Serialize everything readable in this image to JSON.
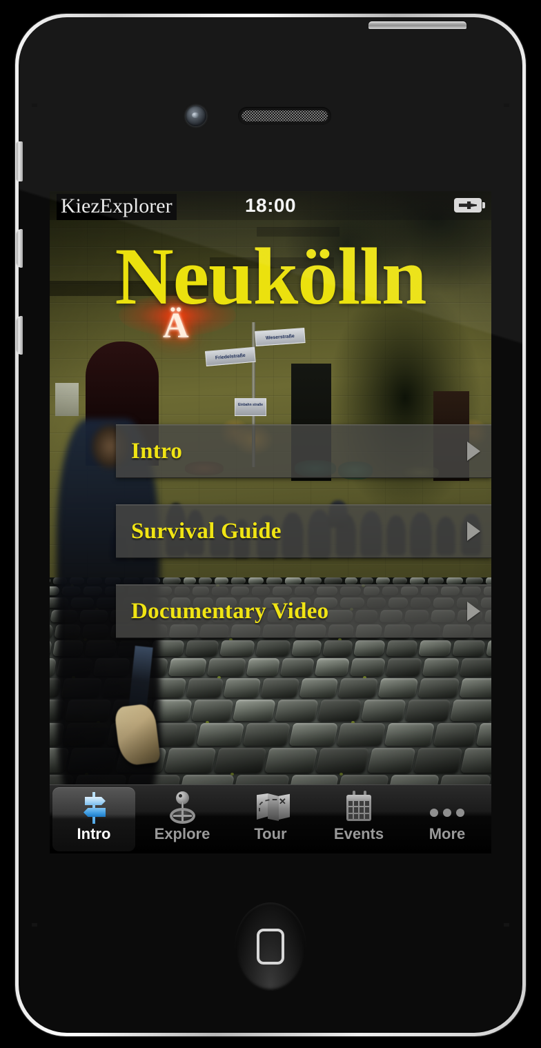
{
  "device": {
    "model_name": "smartphone-mockup",
    "buttons": {
      "power": "power-button",
      "mute": "mute-switch",
      "volume_up": "volume-up-button",
      "volume_down": "volume-down-button",
      "home": "home-button"
    }
  },
  "status_bar": {
    "app_name": "KiezExplorer",
    "time": "18:00",
    "battery_icon": "battery-charging-icon"
  },
  "hero": {
    "title": "Neukölln",
    "title_color": "#ebe10e",
    "background_photo": "night-street-scene-cobblestones"
  },
  "menu": {
    "items": [
      {
        "label": "Intro",
        "chevron": "chevron-right-icon"
      },
      {
        "label": "Survival Guide",
        "chevron": "chevron-right-icon"
      },
      {
        "label": "Documentary Video",
        "chevron": "chevron-right-icon"
      }
    ]
  },
  "tab_bar": {
    "active_index": 0,
    "tabs": [
      {
        "label": "Intro",
        "icon": "signpost-icon"
      },
      {
        "label": "Explore",
        "icon": "location-gyroscope-icon"
      },
      {
        "label": "Tour",
        "icon": "folded-map-icon"
      },
      {
        "label": "Events",
        "icon": "calendar-icon"
      },
      {
        "label": "More",
        "icon": "ellipsis-icon"
      }
    ]
  },
  "photo_details": {
    "neon_letter": "Ä",
    "street_sign_1": "Weserstraße",
    "street_sign_2": "Friedelstraße",
    "street_sign_3": "Einbahn straße"
  },
  "colors": {
    "accent_yellow": "#ebe10e",
    "menu_label_yellow": "#f0e414",
    "tab_active_blue": "#4fa8e8",
    "tab_inactive_gray": "#9a9a9a",
    "menu_row_bg": "rgba(72,72,70,0.80)"
  }
}
